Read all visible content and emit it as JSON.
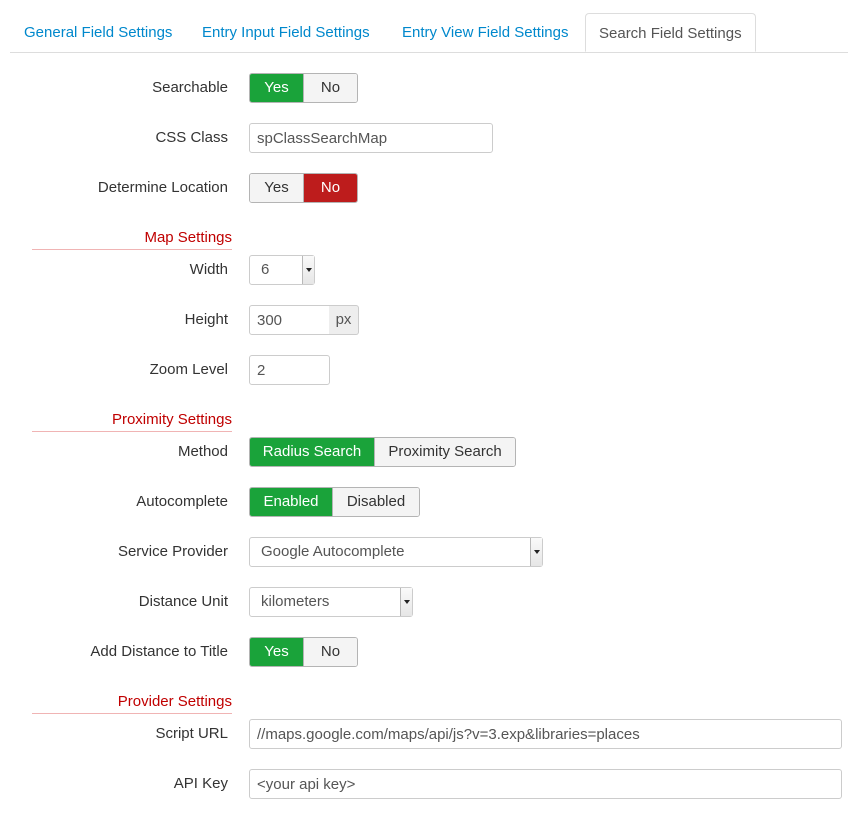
{
  "tabs": [
    {
      "label": "General Field Settings"
    },
    {
      "label": "Entry Input Field Settings"
    },
    {
      "label": "Entry View Field Settings"
    },
    {
      "label": "Search Field Settings"
    }
  ],
  "active_tab": "Search Field Settings",
  "colors": {
    "accent_green": "#1aa33a",
    "accent_red": "#bd1c1c",
    "link": "#0088cc",
    "section": "#c00000"
  },
  "searchable": {
    "label": "Searchable",
    "yes": "Yes",
    "no": "No",
    "selected": "Yes"
  },
  "css_class": {
    "label": "CSS Class",
    "value": "spClassSearchMap"
  },
  "determine_location": {
    "label": "Determine Location",
    "yes": "Yes",
    "no": "No",
    "selected": "No"
  },
  "map_settings": {
    "title": "Map Settings"
  },
  "width": {
    "label": "Width",
    "value": "6"
  },
  "height": {
    "label": "Height",
    "value": "300",
    "unit": "px"
  },
  "zoom": {
    "label": "Zoom Level",
    "value": "2"
  },
  "proximity_settings": {
    "title": "Proximity Settings"
  },
  "method": {
    "label": "Method",
    "radius": "Radius Search",
    "proximity": "Proximity Search",
    "selected": "Radius Search"
  },
  "autocomplete": {
    "label": "Autocomplete",
    "enabled": "Enabled",
    "disabled": "Disabled",
    "selected": "Enabled"
  },
  "service_provider": {
    "label": "Service Provider",
    "value": "Google Autocomplete"
  },
  "distance_unit": {
    "label": "Distance Unit",
    "value": "kilometers"
  },
  "add_distance": {
    "label": "Add Distance to Title",
    "yes": "Yes",
    "no": "No",
    "selected": "Yes"
  },
  "provider_settings": {
    "title": "Provider Settings"
  },
  "script_url": {
    "label": "Script URL",
    "value": "//maps.google.com/maps/api/js?v=3.exp&libraries=places"
  },
  "api_key": {
    "label": "API Key",
    "value": "<your api key>"
  }
}
